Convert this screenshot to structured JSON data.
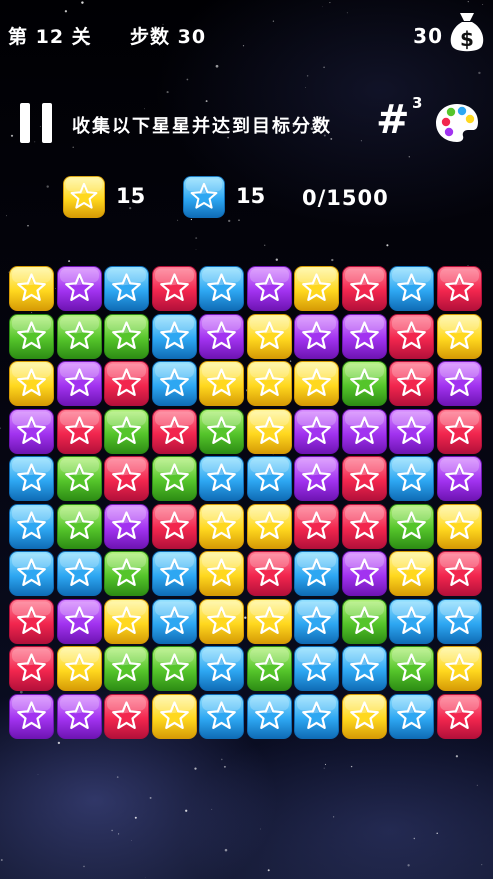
{
  "hud": {
    "level_label": "第 12 关",
    "steps_label": "步数 30",
    "coins": "30",
    "coin_icon": "money-bag-icon"
  },
  "instruction": "收集以下星星并达到目标分数",
  "grid_button": {
    "symbol": "#",
    "superscript": "3"
  },
  "goals": [
    {
      "color": "yellow",
      "count": "15"
    },
    {
      "color": "blue",
      "count": "15"
    }
  ],
  "score_progress": "0/1500",
  "palette": {
    "red": [
      "#ff7d93",
      "#f2264e",
      "#b3103a"
    ],
    "purple": [
      "#d88dff",
      "#a233f0",
      "#6e14b3"
    ],
    "blue": [
      "#93e1ff",
      "#2ea7f2",
      "#0f6cb6"
    ],
    "yellow": [
      "#fff7a0",
      "#ffd81f",
      "#d69a05"
    ],
    "green": [
      "#b4f27d",
      "#55c52b",
      "#2d8c14"
    ]
  },
  "board": [
    [
      "Y",
      "P",
      "B",
      "R",
      "B",
      "P",
      "Y",
      "R",
      "B",
      "R"
    ],
    [
      "G",
      "G",
      "G",
      "B",
      "P",
      "Y",
      "P",
      "P",
      "R",
      "Y"
    ],
    [
      "Y",
      "P",
      "R",
      "B",
      "Y",
      "Y",
      "Y",
      "G",
      "R",
      "P"
    ],
    [
      "P",
      "R",
      "G",
      "R",
      "G",
      "Y",
      "P",
      "P",
      "P",
      "R"
    ],
    [
      "B",
      "G",
      "R",
      "G",
      "B",
      "B",
      "P",
      "R",
      "B",
      "P"
    ],
    [
      "B",
      "G",
      "P",
      "R",
      "Y",
      "Y",
      "R",
      "R",
      "G",
      "Y"
    ],
    [
      "B",
      "B",
      "G",
      "B",
      "Y",
      "R",
      "B",
      "P",
      "Y",
      "R"
    ],
    [
      "R",
      "P",
      "Y",
      "B",
      "Y",
      "Y",
      "B",
      "G",
      "B",
      "B"
    ],
    [
      "R",
      "Y",
      "G",
      "G",
      "B",
      "G",
      "B",
      "B",
      "G",
      "Y"
    ],
    [
      "P",
      "P",
      "R",
      "Y",
      "B",
      "B",
      "B",
      "Y",
      "B",
      "R"
    ]
  ]
}
